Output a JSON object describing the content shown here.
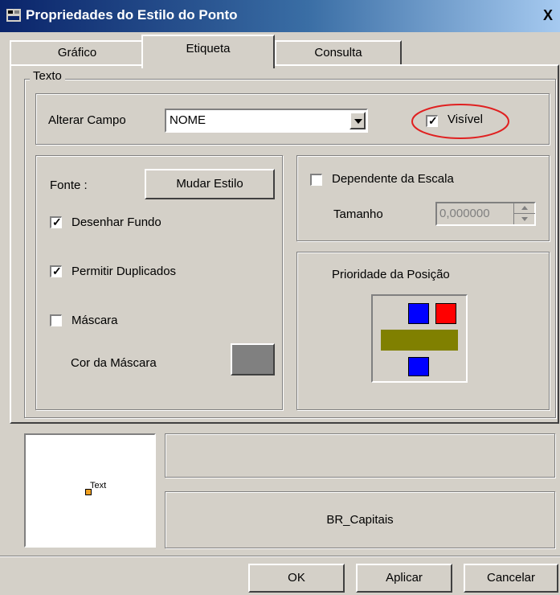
{
  "window": {
    "title": "Propriedades do Estilo do Ponto",
    "close_label": "X"
  },
  "tabs": [
    {
      "label": "Gráfico"
    },
    {
      "label": "Etiqueta"
    },
    {
      "label": "Consulta"
    }
  ],
  "texto_group": {
    "title": "Texto",
    "alterar_campo_label": "Alterar Campo",
    "campo_value": "NOME",
    "visivel_label": "Visível",
    "visivel_checked": true
  },
  "fonte_group": {
    "fonte_label": "Fonte :",
    "mudar_estilo_label": "Mudar Estilo",
    "desenhar_fundo_label": "Desenhar Fundo",
    "desenhar_fundo_checked": true,
    "permitir_duplicados_label": "Permitir Duplicados",
    "permitir_duplicados_checked": true,
    "mascara_label": "Máscara",
    "mascara_checked": false,
    "cor_mascara_label": "Cor da Máscara",
    "cor_mascara_color": "#808080"
  },
  "escala_group": {
    "dependente_label": "Dependente da Escala",
    "dependente_checked": false,
    "tamanho_label": "Tamanho",
    "tamanho_value": "0,000000"
  },
  "prioridade_group": {
    "title": "Prioridade da Posição",
    "colors": {
      "top_left": "#0000ff",
      "top_right": "#ff0000",
      "bar": "#808000",
      "bottom": "#0000ff"
    }
  },
  "preview": {
    "sample_text": "Text",
    "layer_name": "BR_Capitais"
  },
  "buttons": {
    "ok": "OK",
    "aplicar": "Aplicar",
    "cancelar": "Cancelar"
  },
  "colors": {
    "annotation_circle": "#e02020",
    "titlebar_start": "#0a246a"
  }
}
